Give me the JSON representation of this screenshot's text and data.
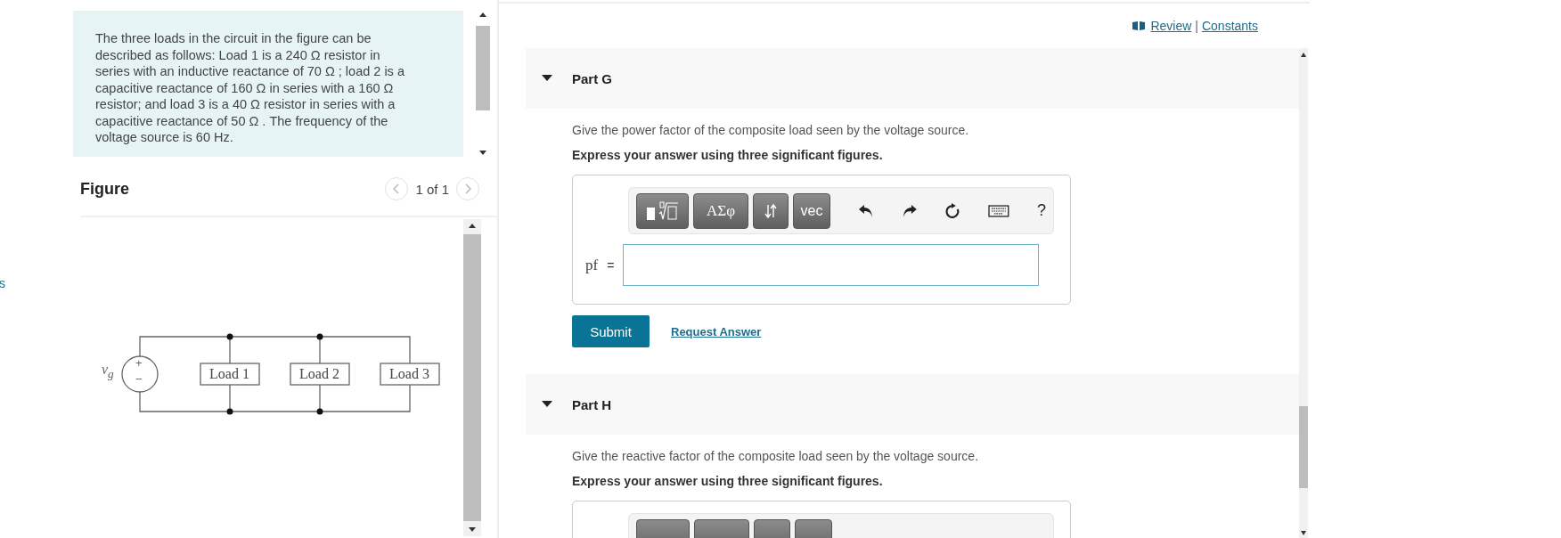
{
  "edge_link": "s",
  "problem": {
    "text": "The three loads in the circuit in the figure can be described as follows: Load 1 is a 240 Ω resistor in series with an inductive reactance of 70 Ω ; load 2 is a capacitive reactance of 160 Ω in series with a 160 Ω resistor; and load 3 is a 40 Ω resistor in series with a capacitive reactance of 50 Ω . The frequency of the voltage source is 60 Hz."
  },
  "figure": {
    "title": "Figure",
    "pager": "1 of 1",
    "source_label": "v$_{g}$",
    "source_plus": "+",
    "source_minus": "−",
    "loads": [
      "Load 1",
      "Load 2",
      "Load 3"
    ]
  },
  "header_links": {
    "review": "Review",
    "separator": "|",
    "constants": "Constants"
  },
  "parts": [
    {
      "title": "Part G",
      "expanded": true,
      "prompt": "Give the power factor of the composite load seen by the voltage source.",
      "instruction": "Express your answer using three significant figures.",
      "greek": "ΑΣφ",
      "vec": "vec",
      "help": "?",
      "variable": "pf",
      "equals": "=",
      "submit": "Submit",
      "request": "Request Answer"
    },
    {
      "title": "Part H",
      "expanded": true,
      "prompt": "Give the reactive factor of the composite load seen by the voltage source.",
      "instruction": "Express your answer using three significant figures."
    }
  ]
}
